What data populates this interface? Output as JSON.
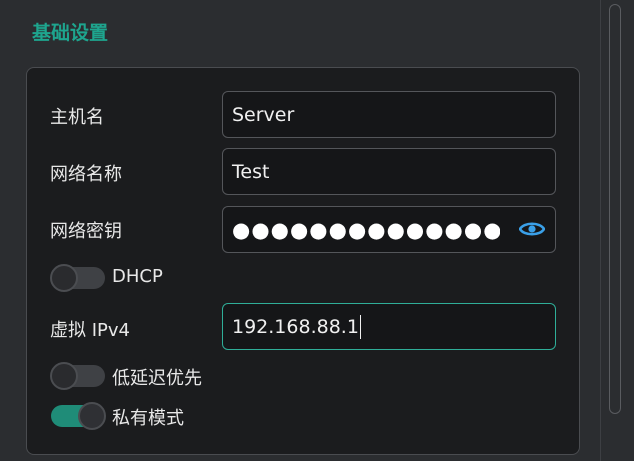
{
  "section": {
    "title": "基础设置"
  },
  "fields": {
    "hostname": {
      "label": "主机名",
      "value": "Server"
    },
    "network_name": {
      "label": "网络名称",
      "value": "Test"
    },
    "network_key": {
      "label": "网络密钥",
      "masked_value": "●●●●●●●●●●●●●●●"
    },
    "virtual_ipv4": {
      "label": "虚拟 IPv4",
      "value": "192.168.88.1"
    }
  },
  "toggles": {
    "dhcp": {
      "label": "DHCP",
      "on": false
    },
    "low_latency": {
      "label": "低延迟优先",
      "on": false
    },
    "private_mode": {
      "label": "私有模式",
      "on": true
    }
  },
  "colors": {
    "accent": "#1ea58e",
    "eye_icon": "#3aa0e8"
  }
}
